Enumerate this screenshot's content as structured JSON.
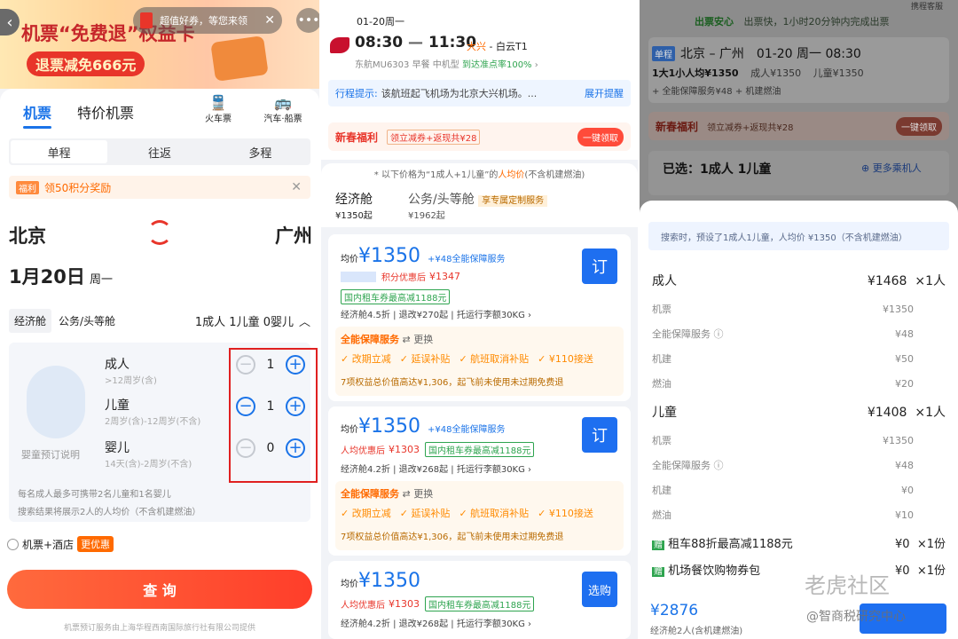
{
  "panel1": {
    "banner": {
      "title": "机票“免费退”权益卡",
      "subtitle": "退票减免666元",
      "toast": "超值好券，等您来领"
    },
    "tabs": {
      "flights": "机票",
      "special": "特价机票",
      "train": "火车票",
      "bus": "汽车·船票"
    },
    "trip_types": [
      "单程",
      "往返",
      "多程"
    ],
    "promo": {
      "badge": "福利",
      "text": "领50积分奖励"
    },
    "route": {
      "from": "北京",
      "to": "广州"
    },
    "date": {
      "date": "1月20日",
      "weekday": "周一"
    },
    "cabin_tabs": [
      "经济舱",
      "公务/头等舱"
    ],
    "passenger_summary": "1成人 1儿童 0婴儿",
    "passengers": [
      {
        "name": "成人",
        "desc": ">12周岁(含)",
        "count": "1"
      },
      {
        "name": "儿童",
        "desc": "2周岁(含)-12周岁(不含)",
        "count": "1"
      },
      {
        "name": "婴儿",
        "desc": "14天(含)-2周岁(不含)",
        "count": "0"
      }
    ],
    "infant_note": "婴童预订说明",
    "notes": [
      "每名成人最多可携带2名儿童和1名婴儿",
      "搜索结果将展示2人的人均价（不含机建燃油）"
    ],
    "hotel_option": {
      "label": "机票+酒店",
      "badge": "更优惠"
    },
    "search_button": "查 询",
    "footer": "机票预订服务由上海华程西南国际旅行社有限公司提供"
  },
  "panel2": {
    "date": "01-20周一",
    "depart_time": "08:30",
    "arrive_time": "11:30",
    "depart_airport": "大兴",
    "arrive_airport": "白云T1",
    "flight_info": "东航MU6303",
    "meal": "早餐",
    "aircraft": "中机型",
    "ontime": "到达准点率100%",
    "notice_label": "行程提示:",
    "notice_text": "该航班起飞机场为北京大兴机场。...",
    "notice_expand": "展开提醒",
    "newyear": "新春福利",
    "newyear_text": "领立减券+返现共¥28",
    "newyear_btn": "一键领取",
    "price_note_pre": "* 以下价格为“1成人+1儿童”的",
    "price_note_hl": "人均价",
    "price_note_post": "(不含机建燃油)",
    "cabins": [
      {
        "name": "经济舱",
        "price": "¥1350起"
      },
      {
        "name": "公务/头等舱",
        "price": "¥1962起",
        "tag": "享专属定制服务"
      }
    ],
    "offers": [
      {
        "avg_label": "均价",
        "price": "¥1350",
        "addon": "+¥48全能保障服务",
        "discount": "积分优惠后",
        "discount_price": "¥1347",
        "car": "国内租车券最高减1188元",
        "details": [
          "经济舱4.5折",
          "退改¥270起",
          "托运行李额30KG"
        ],
        "package_title": "全能保障服务",
        "package_change": "更换",
        "benefits": [
          "改期立减",
          "延误补贴",
          "航班取消补贴",
          "¥110接送"
        ],
        "benefit_note": "7项权益总价值高达¥1,306，起飞前未使用未过期免费退",
        "button": "订"
      },
      {
        "avg_label": "均价",
        "price": "¥1350",
        "addon": "+¥48全能保障服务",
        "discount": "人均优惠后",
        "discount_price": "¥1303",
        "car": "国内租车券最高减1188元",
        "details": [
          "经济舱4.2折",
          "退改¥268起",
          "托运行李额30KG"
        ],
        "package_title": "全能保障服务",
        "package_change": "更换",
        "benefits": [
          "改期立减",
          "延误补贴",
          "航班取消补贴",
          "¥110接送"
        ],
        "benefit_note": "7项权益总价值高达¥1,306，起飞前未使用未过期免费退",
        "button": "订"
      },
      {
        "avg_label": "均价",
        "price": "¥1350",
        "discount": "人均优惠后",
        "discount_price": "¥1303",
        "car": "国内租车券最高减1188元",
        "details": [
          "经济舱4.2折",
          "退改¥268起",
          "托运行李额30KG"
        ],
        "button": "选购"
      }
    ]
  },
  "panel3": {
    "top_label": "出票安心",
    "top_text": "出票快，1小时20分钟内完成出票",
    "corner": "携程客服",
    "single": "单程",
    "route": "北京 – 广州",
    "datetime": "01-20 周一 08:30",
    "avg": "1大1小人均¥1350",
    "adult_price": "成人¥1350",
    "child_price": "儿童¥1350",
    "extras": "+ 全能保障服务¥48 + 机建燃油",
    "newyear": "新春福利",
    "newyear_text": "领立减券+返现共¥28",
    "newyear_btn": "一键领取",
    "selected": "已选：1成人 1儿童",
    "more": "更多乘机人",
    "search_note": "搜索时，预设了1成人1儿童，人均价 ¥1350（不含机建燃油）",
    "adult": {
      "label": "成人",
      "total": "¥1468",
      "qty": "×1人",
      "items": [
        {
          "name": "机票",
          "value": "¥1350"
        },
        {
          "name": "全能保障服务",
          "value": "¥48"
        },
        {
          "name": "机建",
          "value": "¥50"
        },
        {
          "name": "燃油",
          "value": "¥20"
        }
      ]
    },
    "child": {
      "label": "儿童",
      "total": "¥1408",
      "qty": "×1人",
      "items": [
        {
          "name": "机票",
          "value": "¥1350"
        },
        {
          "name": "全能保障服务",
          "value": "¥48"
        },
        {
          "name": "机建",
          "value": "¥0"
        },
        {
          "name": "燃油",
          "value": "¥10"
        }
      ]
    },
    "gifts": [
      {
        "badge": "赠",
        "text": "租车88折最高减1188元",
        "value": "¥0",
        "qty": "×1份"
      },
      {
        "badge": "赠",
        "text": "机场餐饮购物券包",
        "value": "¥0",
        "qty": "×1份"
      }
    ],
    "total": "¥2876",
    "total_note": "经济舱2人(含机建燃油)",
    "watermark": "老虎社区",
    "watermark2": "@智商税研究中心"
  }
}
